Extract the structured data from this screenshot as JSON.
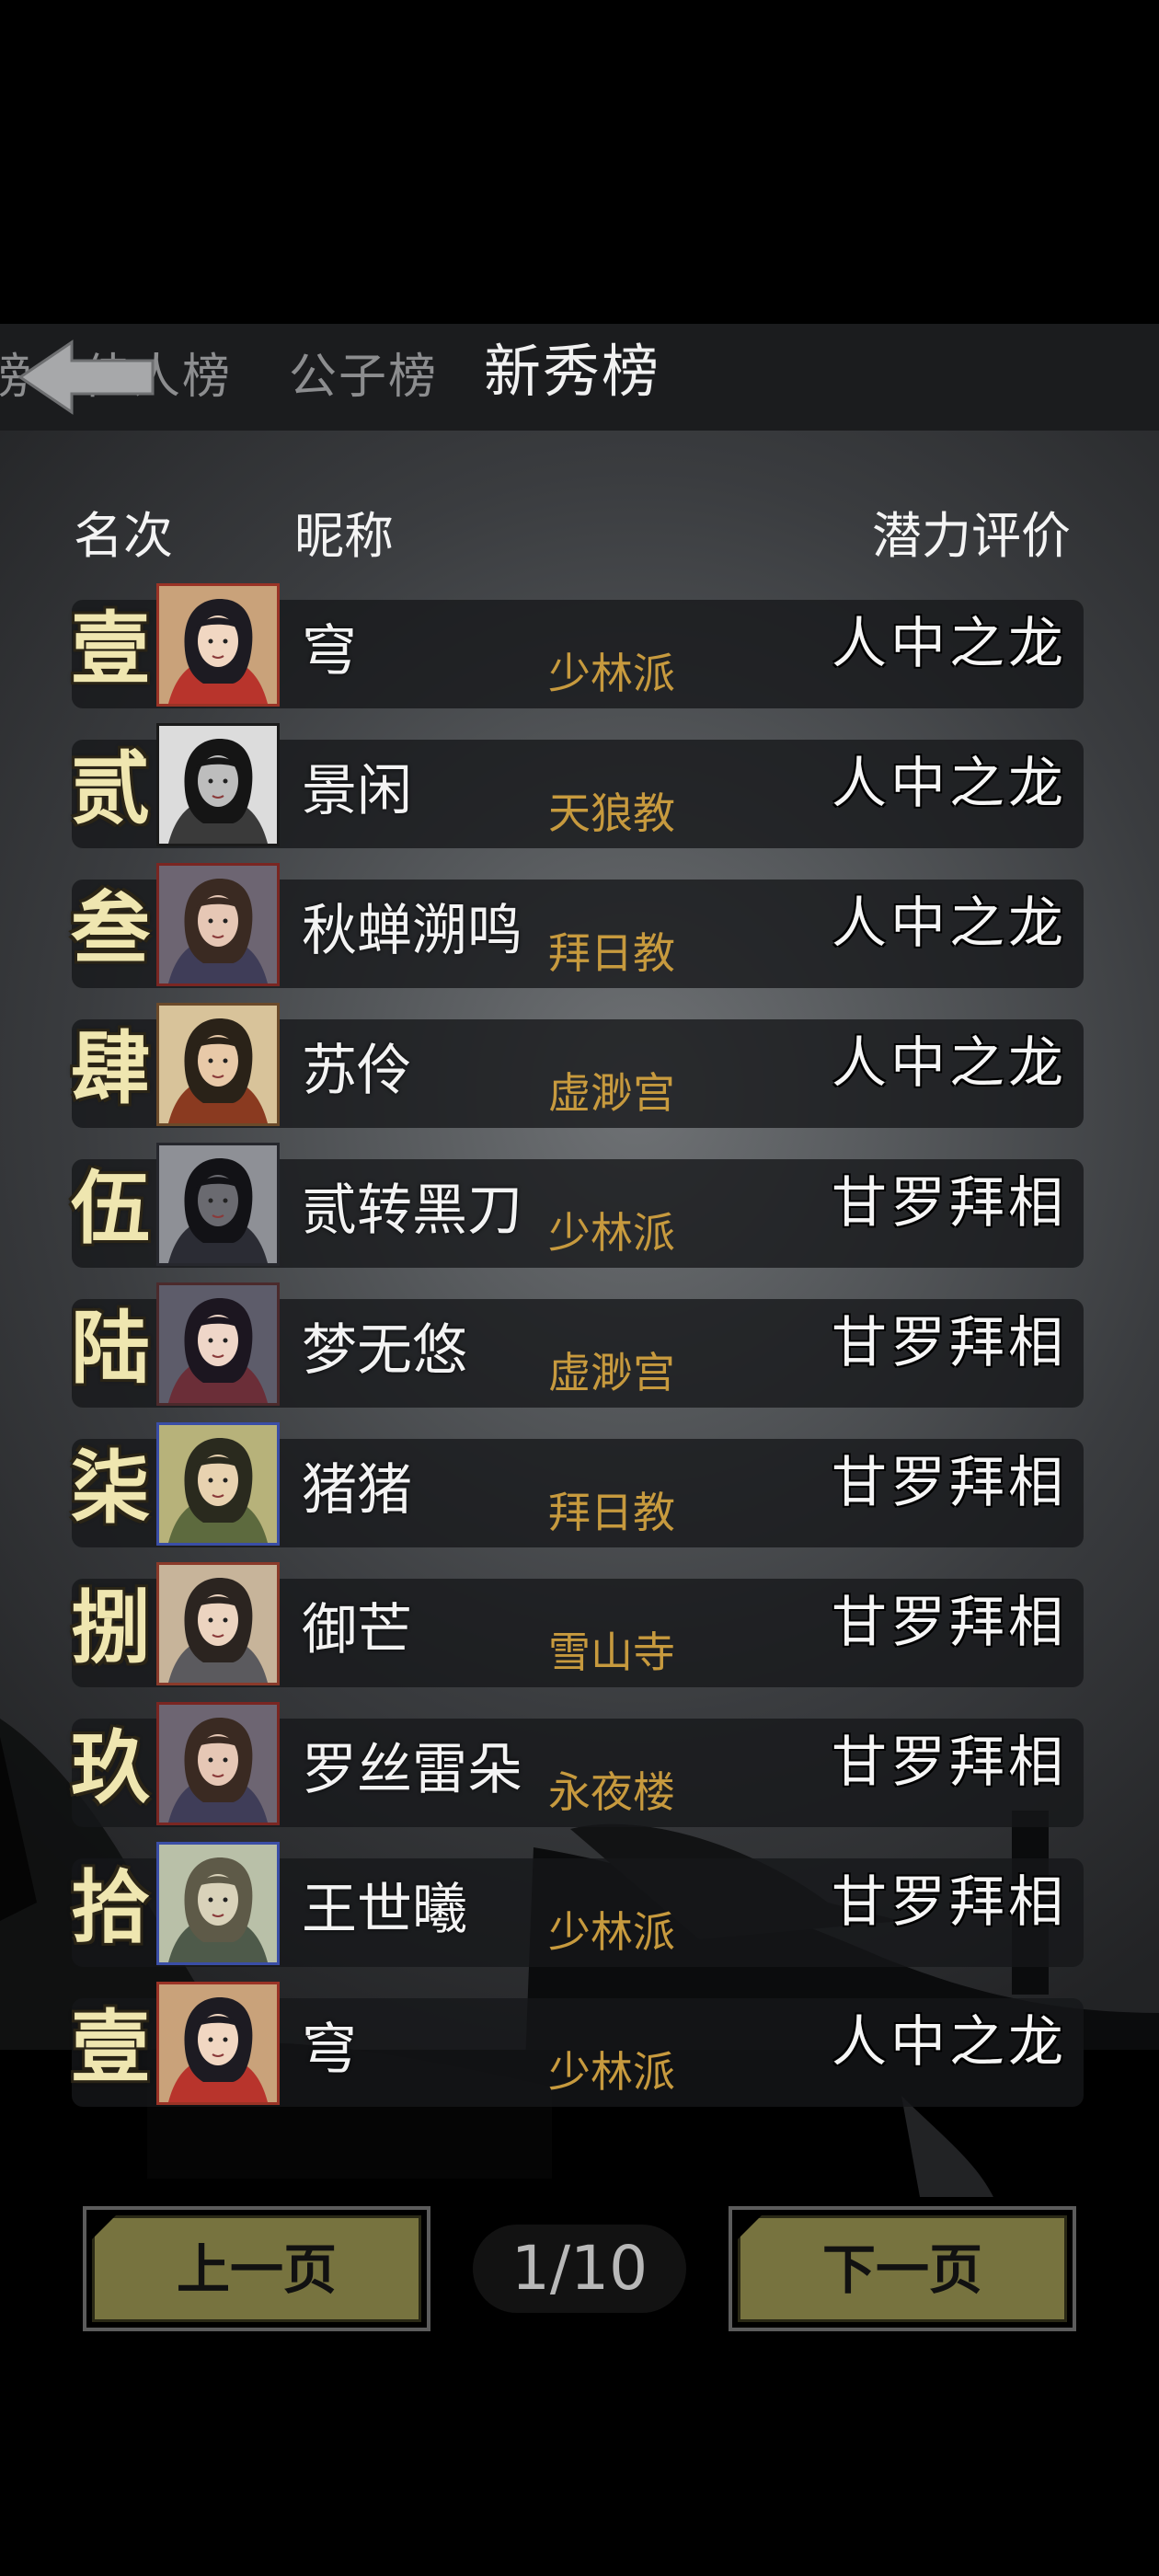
{
  "tabs": [
    {
      "label": "榜"
    },
    {
      "label": "佳人榜"
    },
    {
      "label": "公子榜"
    },
    {
      "label": "新秀榜",
      "active": true
    }
  ],
  "header": {
    "rank_label": "名次",
    "name_label": "昵称",
    "rating_label": "潜力评价"
  },
  "rows": [
    {
      "rank": "壹",
      "name": "穹",
      "sect": "少林派",
      "rating": "人中之龙",
      "avatar": "avatar-warrior-woman-red"
    },
    {
      "rank": "贰",
      "name": "景闲",
      "sect": "天狼教",
      "rating": "人中之龙",
      "avatar": "avatar-ink-swordsman"
    },
    {
      "rank": "叁",
      "name": "秋蝉溯鸣",
      "sect": "拜日教",
      "rating": "人中之龙",
      "avatar": "avatar-archer-woman"
    },
    {
      "rank": "肆",
      "name": "苏伶",
      "sect": "虚渺宫",
      "rating": "人中之龙",
      "avatar": "avatar-helmet-warrior"
    },
    {
      "rank": "伍",
      "name": "贰转黑刀",
      "sect": "少林派",
      "rating": "甘罗拜相",
      "avatar": "avatar-dark-blade"
    },
    {
      "rank": "陆",
      "name": "梦无悠",
      "sect": "虚渺宫",
      "rating": "甘罗拜相",
      "avatar": "avatar-flower-woman"
    },
    {
      "rank": "柒",
      "name": "猪猪",
      "sect": "拜日教",
      "rating": "甘罗拜相",
      "avatar": "avatar-scholar-woman"
    },
    {
      "rank": "捌",
      "name": "御芒",
      "sect": "雪山寺",
      "rating": "甘罗拜相",
      "avatar": "avatar-winged-woman"
    },
    {
      "rank": "玖",
      "name": "罗丝雷朵",
      "sect": "永夜楼",
      "rating": "甘罗拜相",
      "avatar": "avatar-archer-woman"
    },
    {
      "rank": "拾",
      "name": "王世曦",
      "sect": "少林派",
      "rating": "甘罗拜相",
      "avatar": "avatar-horse"
    },
    {
      "rank": "壹",
      "name": "穹",
      "sect": "少林派",
      "rating": "人中之龙",
      "avatar": "avatar-warrior-woman-red"
    }
  ],
  "pagination": {
    "prev_label": "上一页",
    "next_label": "下一页",
    "indicator": "1/10"
  },
  "icons": {
    "back": "back-arrow-icon"
  },
  "colors": {
    "sect_text": "#c79a3e",
    "rank_text": "#efe6b0",
    "button_face": "#77733f"
  }
}
